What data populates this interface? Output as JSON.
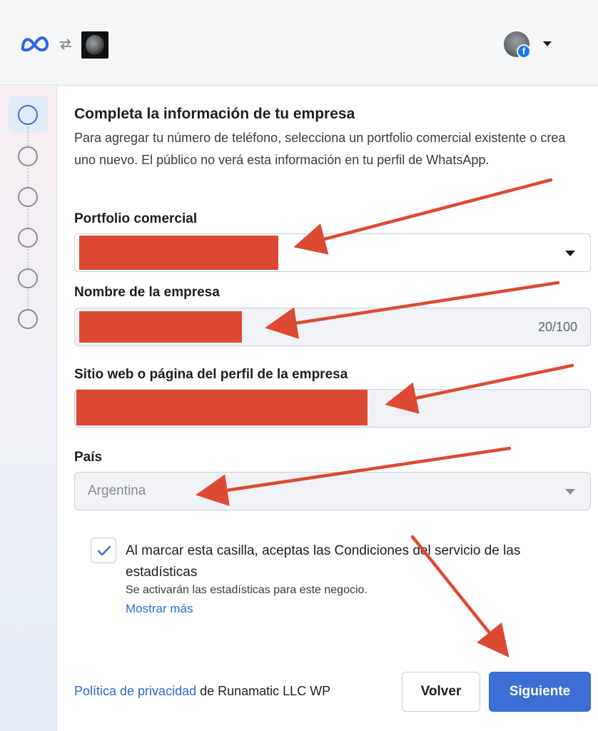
{
  "colors": {
    "accent": "#3b6fd6",
    "link": "#2d6ac9",
    "redaction": "#dd4a33",
    "annotation_arrow": "#dd4a33"
  },
  "header": {
    "logo_icon": "meta-logo-icon",
    "swap_icon": "swap-arrows-icon",
    "app_icon": "app-thumbnail-icon",
    "profile_icon": "avatar-with-facebook-badge",
    "fb_badge": "f"
  },
  "stepper": {
    "steps": 6,
    "active_index": 0
  },
  "form": {
    "title": "Completa la información de tu empresa",
    "description": "Para agregar tu número de teléfono, selecciona un portfolio comercial existente o crea uno nuevo. El público no verá esta información en tu perfil de WhatsApp.",
    "portfolio": {
      "label": "Portfolio comercial"
    },
    "company_name": {
      "label": "Nombre de la empresa",
      "counter": "20/100"
    },
    "website": {
      "label": "Sitio web o página del perfil de la empresa"
    },
    "country": {
      "label": "País",
      "value": "Argentina"
    },
    "consent": {
      "checked": true,
      "text": "Al marcar esta casilla, aceptas las Condiciones del servicio de las estadísticas",
      "sub": "Se activarán las estadísticas para este negocio.",
      "more_link": "Mostrar más"
    }
  },
  "footer": {
    "privacy_link": "Política de privacidad",
    "privacy_suffix": " de Runamatic LLC WP",
    "back_button": "Volver",
    "next_button": "Siguiente"
  }
}
